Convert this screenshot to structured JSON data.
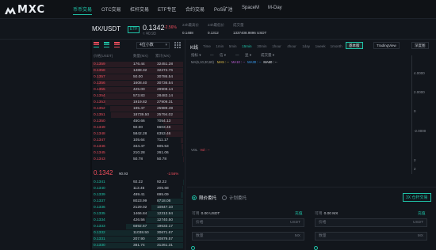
{
  "nav": {
    "brand": "MXC",
    "items": [
      "币币交易",
      "OTC交易",
      "杠杆交易",
      "ETF专区",
      "合约交易",
      "PoS矿池",
      "SpaceM",
      "M-Day"
    ]
  },
  "ticker": {
    "pair": "MX/USDT",
    "etf_badge": "ETF",
    "last_price": "0.1342",
    "change": "-2.56%",
    "approx": "≈ ¥0.93",
    "stats": [
      {
        "label": "24h最高价",
        "value": "0.1488"
      },
      {
        "label": "24h最低价",
        "value": "0.1312"
      },
      {
        "label": "成交量",
        "value": "1337408.9896 USDT"
      }
    ]
  },
  "orderbook": {
    "depth_select": "4位小数",
    "headers": [
      "价格(USDT)",
      "数量(MX)",
      "累计(MX)"
    ],
    "asks": [
      [
        "0.1359",
        "176.44",
        "32451.28"
      ],
      [
        "0.1358",
        "1488.32",
        "32274.76"
      ],
      [
        "0.1357",
        "50.00",
        "30786.54"
      ],
      [
        "0.1356",
        "1608.40",
        "30736.54"
      ],
      [
        "0.1355",
        "425.00",
        "29908.14"
      ],
      [
        "0.1354",
        "573.83",
        "28483.14"
      ],
      [
        "0.1353",
        "1919.82",
        "27909.31"
      ],
      [
        "0.1352",
        "195.47",
        "25989.49"
      ],
      [
        "0.1351",
        "18739.50",
        "25794.02"
      ],
      [
        "0.1350",
        "450.66",
        "7054.13"
      ],
      [
        "0.1349",
        "50.00",
        "6603.46"
      ],
      [
        "0.1348",
        "5842.28",
        "6353.46"
      ],
      [
        "0.1347",
        "105.64",
        "711.17"
      ],
      [
        "0.1346",
        "344.47",
        "605.53"
      ],
      [
        "0.1345",
        "210.28",
        "261.06"
      ],
      [
        "0.1343",
        "50.78",
        "50.78"
      ]
    ],
    "mid": {
      "price": "0.1342",
      "cny": "¥0.93",
      "change": "-2.56%"
    },
    "bids": [
      [
        "0.1341",
        "92.22",
        "92.22"
      ],
      [
        "0.1340",
        "113.46",
        "205.68"
      ],
      [
        "0.1339",
        "489.41",
        "695.09"
      ],
      [
        "0.1337",
        "8023.99",
        "8718.08"
      ],
      [
        "0.1336",
        "2129.02",
        "10847.10"
      ],
      [
        "0.1335",
        "1466.84",
        "12313.94"
      ],
      [
        "0.1334",
        "426.56",
        "12740.50"
      ],
      [
        "0.1333",
        "6892.67",
        "19633.17"
      ],
      [
        "0.1332",
        "11038.50",
        "30671.67"
      ],
      [
        "0.1331",
        "207.90",
        "30879.57"
      ],
      [
        "0.1330",
        "381.74",
        "31261.31"
      ]
    ]
  },
  "chart": {
    "title": "K线",
    "timeframes": [
      "Time",
      "1min",
      "5min",
      "15min",
      "30min",
      "1hour",
      "4hour",
      "1day",
      "1week",
      "1month"
    ],
    "active_timeframe": "15min",
    "views": [
      "基本版",
      "TradingView",
      "深度图"
    ],
    "active_view": "基本版",
    "indicators": [
      "指标 ▾",
      "—",
      "信 ▾",
      "—",
      "显 ▾",
      "成交量 ▾"
    ],
    "ma_label": "MA(5,10,30,60)",
    "ma_items": [
      {
        "label": "MA5 : --",
        "color": "#e6c34a"
      },
      {
        "label": "MA10 : --",
        "color": "#c05fd9"
      },
      {
        "label": "MA30 : --",
        "color": "#3aa3ff"
      },
      {
        "label": "MA60 : --",
        "color": "#e7eaef"
      }
    ],
    "vol_label": "VOL",
    "vol_value": "Vol : --",
    "y_ticks": [
      "4.0000",
      "2.0000",
      "0",
      "-2.0000",
      "2",
      "2"
    ]
  },
  "trade": {
    "limit_label": "限价委托",
    "stop_label": "计划委托",
    "leverage_label": "3X 仓杆交易",
    "buy": {
      "avail_label": "可用",
      "avail_value": "0.00 USDT",
      "deposit": "充值",
      "price_placeholder": "价格",
      "price_unit": "USDT",
      "amount_placeholder": "数量",
      "amount_unit": "MX"
    },
    "sell": {
      "avail_label": "可用",
      "avail_value": "0.00 MX",
      "deposit": "充值",
      "price_placeholder": "价格",
      "price_unit": "USDT",
      "amount_placeholder": "数量",
      "amount_unit": "MX"
    }
  },
  "colors": {
    "accent": "#1fc3a8",
    "ask": "#f04e5d",
    "bid": "#1fc3a8",
    "bg": "#12161c"
  }
}
